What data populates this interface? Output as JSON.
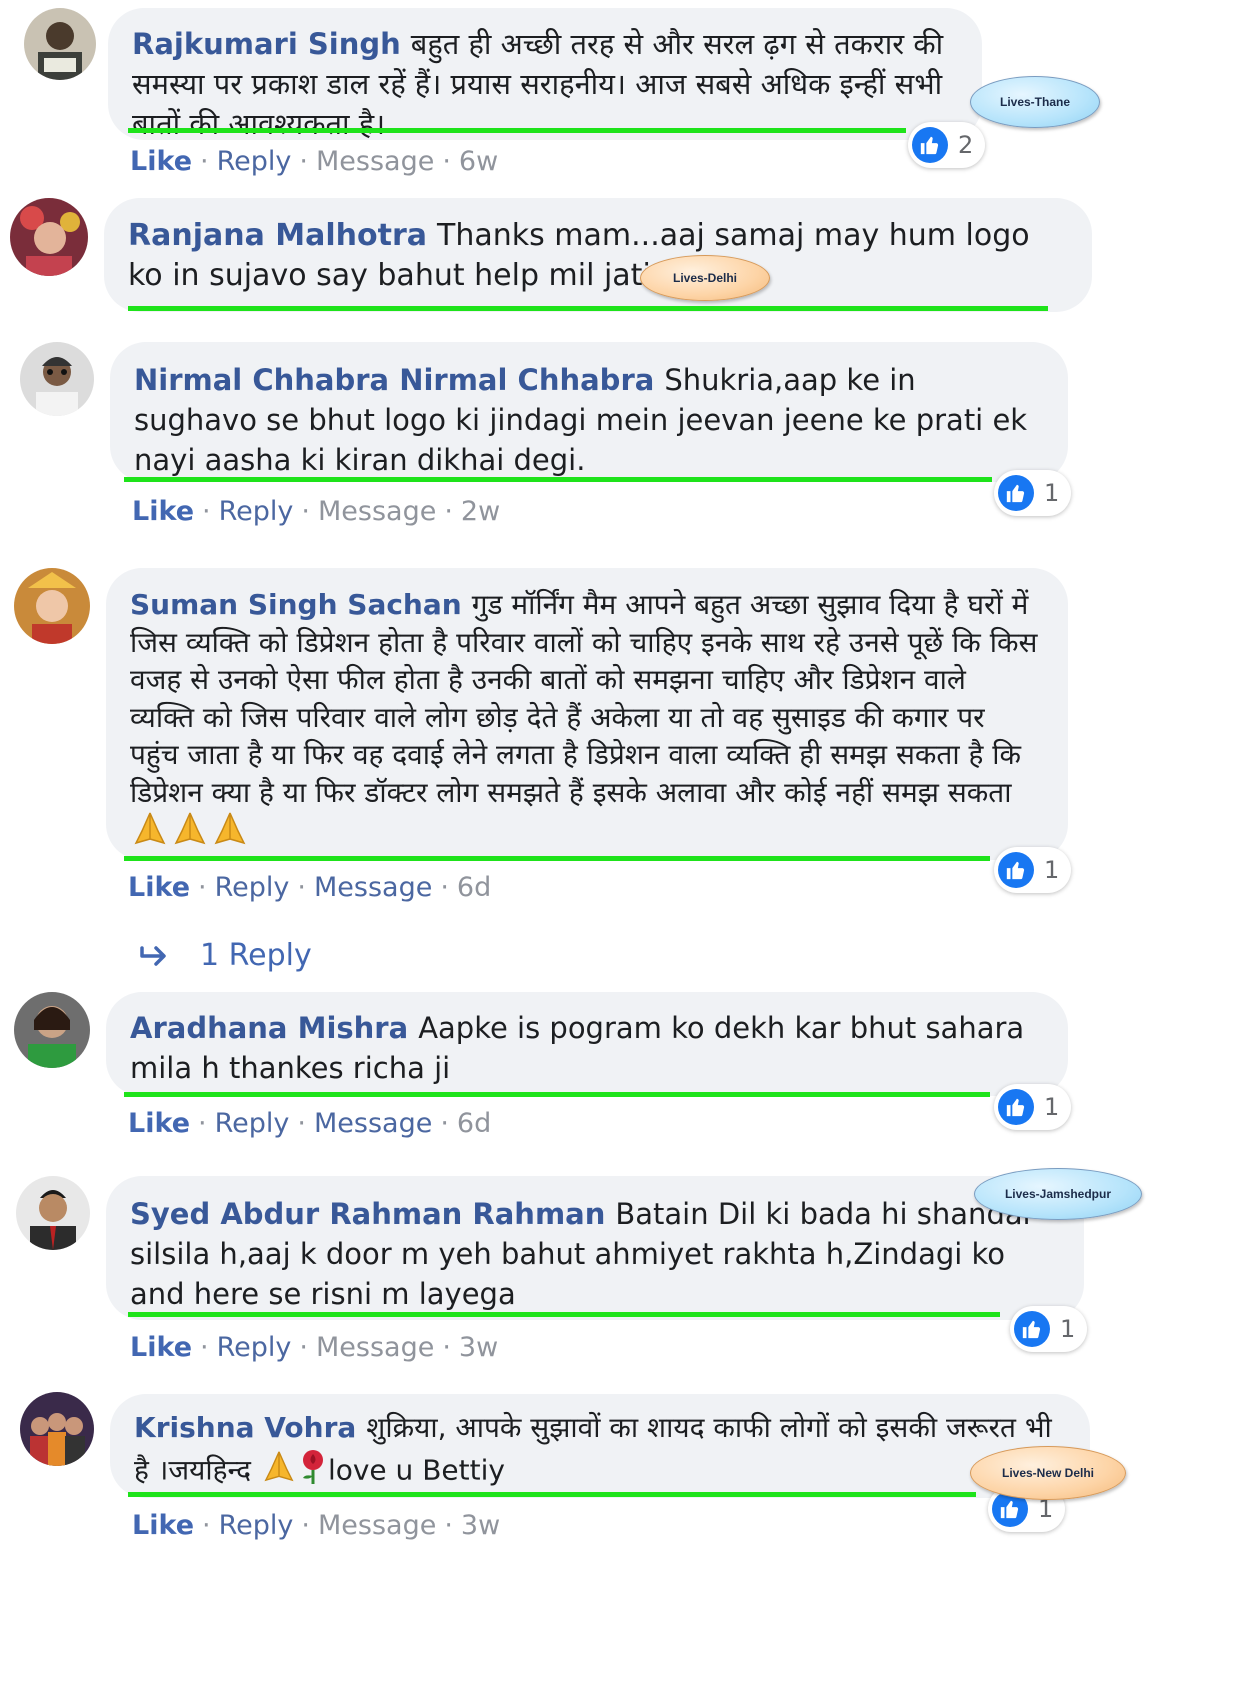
{
  "colors": {
    "author": "#385898",
    "like": "#4267b2",
    "bubble": "#f0f2f5",
    "underline": "#1ee31a",
    "thumb": "#1877f2"
  },
  "comments": [
    {
      "author": "Rajkumari Singh",
      "text": "बहुत ही अच्छी तरह से और सरल ढ़ग से तकरार की समस्या पर प्रकाश डाल रहें हैं। प्रयास सराहनीय। आज सबसे अधिक इन्हीं सभी बातों की आवश्यकता है।",
      "like": "Like",
      "reply": "Reply",
      "message": "Message",
      "time": "6w",
      "reactions": "2",
      "tag": "Lives-Thane"
    },
    {
      "author": "Ranjana Malhotra",
      "text": "Thanks mam...aaj samaj may hum logo ko in sujavo say bahut help mil jati h",
      "tag": "Lives-Delhi"
    },
    {
      "author": "Nirmal Chhabra Nirmal Chhabra",
      "text": "Shukria,aap ke in sughavo se bhut logo ki jindagi mein jeevan jeene ke prati ek nayi aasha ki kiran dikhai degi.",
      "like": "Like",
      "reply": "Reply",
      "message": "Message",
      "time": "2w",
      "reactions": "1"
    },
    {
      "author": "Suman Singh Sachan",
      "text": "गुड मॉर्निंग मैम आपने बहुत अच्छा सुझाव दिया है घरों में जिस व्यक्ति को डिप्रेशन होता है परिवार वालों को चाहिए इनके साथ रहे उनसे पूछें कि किस वजह से उनको ऐसा फील होता है उनकी बातों को समझना चाहिए और डिप्रेशन वाले व्यक्ति को जिस परिवार वाले लोग छोड़ देते हैं अकेला या तो वह सुसाइड की कगार पर पहुंच जाता है या फिर वह दवाई लेने लगता है डिप्रेशन वाला व्यक्ति ही समझ सकता है कि डिप्रेशन क्या है या फिर डॉक्टर लोग समझते हैं इसके अलावा और कोई नहीं समझ सकता",
      "like": "Like",
      "reply": "Reply",
      "message": "Message",
      "time": "6d",
      "reactions": "1",
      "replies_link": "1 Reply"
    },
    {
      "author": "Aradhana Mishra",
      "text": "Aapke is pogram ko dekh kar bhut sahara mila h thankes richa ji",
      "like": "Like",
      "reply": "Reply",
      "message": "Message",
      "time": "6d",
      "reactions": "1"
    },
    {
      "author": "Syed Abdur Rahman Rahman",
      "text": "Batain Dil ki bada hi shandar silsila h,aaj k door m yeh bahut ahmiyet rakhta h,Zindagi ko and here se risni m layega",
      "like": "Like",
      "reply": "Reply",
      "message": "Message",
      "time": "3w",
      "reactions": "1",
      "tag": "Lives-Jamshedpur"
    },
    {
      "author": "Krishna Vohra",
      "text": "शुक्रिया, आपके सुझावों का शायद काफी लोगों को इसकी जरूरत भी है ।जयहिन्द",
      "text_tail": "love u Bettiy",
      "like": "Like",
      "reply": "Reply",
      "message": "Message",
      "time": "3w",
      "reactions": "1",
      "tag": "Lives-New Delhi"
    }
  ],
  "icons": {
    "thumb": "thumbs-up-icon",
    "pray": "folded-hands-icon",
    "rose": "rose-icon",
    "reply_arrow": "reply-arrow-icon"
  }
}
